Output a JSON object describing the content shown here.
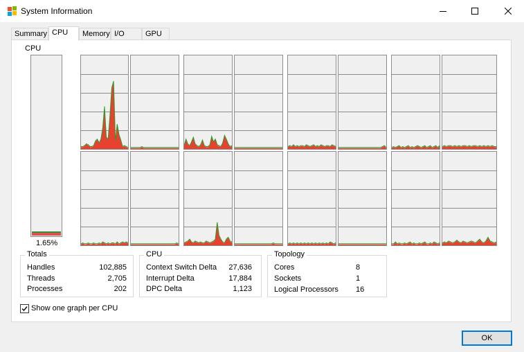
{
  "window": {
    "title": "System Information"
  },
  "tabs": [
    {
      "label": "Summary",
      "active": false
    },
    {
      "label": "CPU",
      "active": true
    },
    {
      "label": "Memory",
      "active": false
    },
    {
      "label": "I/O",
      "active": false
    },
    {
      "label": "GPU",
      "active": false
    }
  ],
  "cpu": {
    "label": "CPU",
    "usage_text": "1.65%",
    "usage_fraction": 0.0165
  },
  "graph_levels": [
    [
      0.2,
      0.2,
      0.3,
      0.5,
      0.4,
      0.2,
      0.2,
      0.3,
      0.8,
      1.0,
      0.6,
      1.0,
      2.2,
      4.5,
      1.2,
      1.0,
      3.5,
      6.5,
      7.2,
      0.8,
      2.6,
      1.5,
      0.9,
      0.2,
      0.3,
      0.2,
      0.1
    ],
    [
      0.1,
      0.1,
      0.1,
      0.1,
      0.1,
      0.1,
      0.2,
      0.1,
      0.1,
      0.1,
      0.1,
      0.1,
      0.1,
      0.1,
      0.1,
      0.1,
      0.1,
      0.1,
      0.1,
      0.1,
      0.1,
      0.1,
      0.1,
      0.1,
      0.1,
      0.1,
      0.1
    ],
    [
      0.3,
      1.0,
      0.5,
      0.3,
      0.7,
      1.2,
      0.5,
      0.3,
      0.2,
      0.4,
      0.9,
      0.3,
      0.2,
      0.2,
      0.4,
      1.3,
      0.7,
      1.0,
      0.4,
      0.3,
      0.2,
      0.6,
      1.4,
      1.0,
      0.5,
      0.2,
      0.3
    ],
    [
      0.1,
      0.1,
      0.1,
      0.1,
      0.1,
      0.1,
      0.1,
      0.1,
      0.1,
      0.1,
      0.1,
      0.1,
      0.1,
      0.1,
      0.1,
      0.1,
      0.1,
      0.1,
      0.1,
      0.1,
      0.1,
      0.1,
      0.1,
      0.1,
      0.1,
      0.1,
      0.1
    ],
    [
      0.2,
      0.3,
      0.2,
      0.4,
      0.2,
      0.3,
      0.2,
      0.3,
      0.3,
      0.2,
      0.4,
      0.3,
      0.2,
      0.3,
      0.4,
      0.2,
      0.3,
      0.2,
      0.4,
      0.3,
      0.2,
      0.3,
      0.3,
      0.2,
      0.4,
      0.3,
      0.2
    ],
    [
      0.1,
      0.1,
      0.1,
      0.1,
      0.1,
      0.1,
      0.1,
      0.1,
      0.1,
      0.1,
      0.1,
      0.1,
      0.1,
      0.1,
      0.1,
      0.1,
      0.1,
      0.1,
      0.1,
      0.1,
      0.1,
      0.1,
      0.1,
      0.1,
      0.2,
      0.3,
      0.1
    ],
    [
      0.1,
      0.2,
      0.1,
      0.2,
      0.3,
      0.1,
      0.2,
      0.1,
      0.2,
      0.3,
      0.1,
      0.2,
      0.1,
      0.2,
      0.3,
      0.2,
      0.1,
      0.2,
      0.3,
      0.1,
      0.2,
      0.3,
      0.1,
      0.2,
      0.3,
      0.1,
      0.3
    ],
    [
      0.2,
      0.3,
      0.2,
      0.3,
      0.3,
      0.2,
      0.3,
      0.2,
      0.3,
      0.2,
      0.3,
      0.3,
      0.2,
      0.3,
      0.2,
      0.3,
      0.3,
      0.2,
      0.3,
      0.2,
      0.3,
      0.2,
      0.3,
      0.2,
      0.3,
      0.2,
      0.2
    ],
    [
      0.1,
      0.2,
      0.1,
      0.1,
      0.2,
      0.1,
      0.1,
      0.2,
      0.1,
      0.1,
      0.2,
      0.1,
      0.3,
      0.2,
      0.1,
      0.2,
      0.1,
      0.2,
      0.2,
      0.1,
      0.3,
      0.1,
      0.2,
      0.3,
      0.2,
      0.3,
      0.2
    ],
    [
      0.1,
      0.1,
      0.1,
      0.1,
      0.1,
      0.1,
      0.1,
      0.1,
      0.1,
      0.1,
      0.1,
      0.1,
      0.1,
      0.1,
      0.1,
      0.1,
      0.1,
      0.1,
      0.1,
      0.1,
      0.1,
      0.1,
      0.1,
      0.1,
      0.1,
      0.2,
      0.1
    ],
    [
      0.2,
      0.3,
      0.4,
      0.6,
      0.3,
      0.2,
      0.4,
      0.3,
      0.2,
      0.3,
      0.2,
      0.2,
      0.4,
      0.3,
      0.2,
      0.3,
      0.4,
      0.6,
      2.4,
      1.0,
      0.6,
      0.3,
      0.2,
      0.6,
      0.8,
      0.4,
      0.3
    ],
    [
      0.1,
      0.1,
      0.1,
      0.1,
      0.1,
      0.1,
      0.1,
      0.1,
      0.1,
      0.1,
      0.1,
      0.1,
      0.1,
      0.1,
      0.1,
      0.1,
      0.1,
      0.1,
      0.1,
      0.1,
      0.1,
      0.2,
      0.1,
      0.1,
      0.1,
      0.1,
      0.1
    ],
    [
      0.1,
      0.2,
      0.1,
      0.2,
      0.1,
      0.2,
      0.1,
      0.2,
      0.1,
      0.2,
      0.1,
      0.2,
      0.1,
      0.2,
      0.1,
      0.2,
      0.1,
      0.2,
      0.1,
      0.2,
      0.1,
      0.2,
      0.1,
      0.3,
      0.2,
      0.1,
      0.2
    ],
    [
      0.1,
      0.1,
      0.1,
      0.1,
      0.1,
      0.1,
      0.1,
      0.1,
      0.1,
      0.1,
      0.1,
      0.1,
      0.1,
      0.1,
      0.1,
      0.1,
      0.1,
      0.1,
      0.1,
      0.1,
      0.1,
      0.1,
      0.1,
      0.1,
      0.1,
      0.1,
      0.1
    ],
    [
      0.1,
      0.1,
      0.3,
      0.1,
      0.2,
      0.1,
      0.1,
      0.2,
      0.1,
      0.2,
      0.3,
      0.1,
      0.2,
      0.1,
      0.1,
      0.2,
      0.1,
      0.2,
      0.3,
      0.1,
      0.1,
      0.2,
      0.1,
      0.3,
      0.2,
      0.1,
      0.2
    ],
    [
      0.2,
      0.3,
      0.2,
      0.4,
      0.3,
      0.2,
      0.3,
      0.5,
      0.3,
      0.2,
      0.4,
      0.3,
      0.2,
      0.3,
      0.4,
      0.3,
      0.2,
      0.4,
      0.6,
      0.3,
      0.2,
      0.4,
      0.8,
      0.4,
      0.3,
      0.2,
      0.3
    ]
  ],
  "totals": {
    "title": "Totals",
    "rows": [
      {
        "label": "Handles",
        "value": "102,885"
      },
      {
        "label": "Threads",
        "value": "2,705"
      },
      {
        "label": "Processes",
        "value": "202"
      }
    ]
  },
  "cpu_stats": {
    "title": "CPU",
    "rows": [
      {
        "label": "Context Switch Delta",
        "value": "27,636"
      },
      {
        "label": "Interrupt Delta",
        "value": "17,884"
      },
      {
        "label": "DPC Delta",
        "value": "1,123"
      }
    ]
  },
  "topology": {
    "title": "Topology",
    "rows": [
      {
        "label": "Cores",
        "value": "8"
      },
      {
        "label": "Sockets",
        "value": "1"
      },
      {
        "label": "Logical Processors",
        "value": "16"
      }
    ]
  },
  "options": {
    "show_one_graph_label": "Show one graph per CPU",
    "show_one_graph_checked": true
  },
  "buttons": {
    "ok_label": "OK"
  },
  "colors": {
    "kernel_fill": "#e8412f",
    "total_line": "#2e9a2e",
    "graph_bg": "#f0f0f0",
    "grid": "#8c8c8c",
    "focus": "#0078d7"
  }
}
